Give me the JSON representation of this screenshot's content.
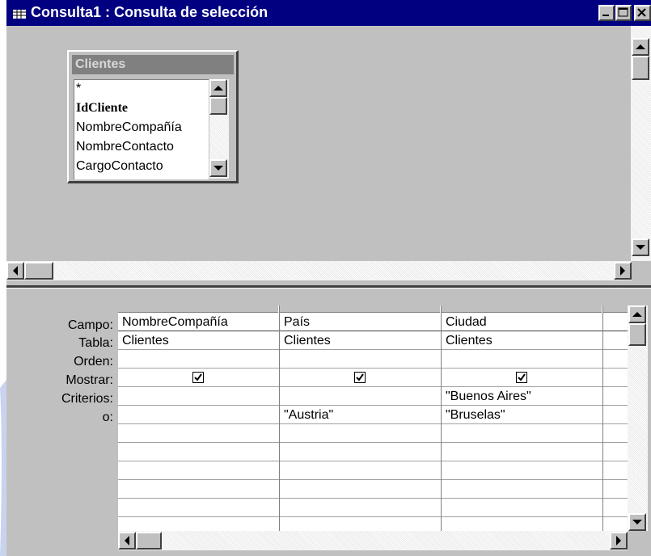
{
  "window": {
    "title": "Consulta1 : Consulta de selección"
  },
  "table_box": {
    "title": "Clientes",
    "fields": [
      "*",
      "IdCliente",
      "NombreCompañía",
      "NombreContacto",
      "CargoContacto"
    ]
  },
  "grid": {
    "row_labels": [
      "Campo:",
      "Tabla:",
      "Orden:",
      "Mostrar:",
      "Criterios:",
      "o:"
    ],
    "columns": [
      {
        "campo": "NombreCompañía",
        "tabla": "Clientes",
        "orden": "",
        "mostrar": true,
        "criterios": "",
        "o": ""
      },
      {
        "campo": "País",
        "tabla": "Clientes",
        "orden": "",
        "mostrar": true,
        "criterios": "",
        "o": "\"Austria\""
      },
      {
        "campo": "Ciudad",
        "tabla": "Clientes",
        "orden": "",
        "mostrar": true,
        "criterios": "\"Buenos Aires\"",
        "o": "\"Bruselas\""
      }
    ]
  },
  "colors": {
    "title_bar": "#000080",
    "window_face": "#c0c0c0",
    "table_title_inactive": "#808080"
  }
}
